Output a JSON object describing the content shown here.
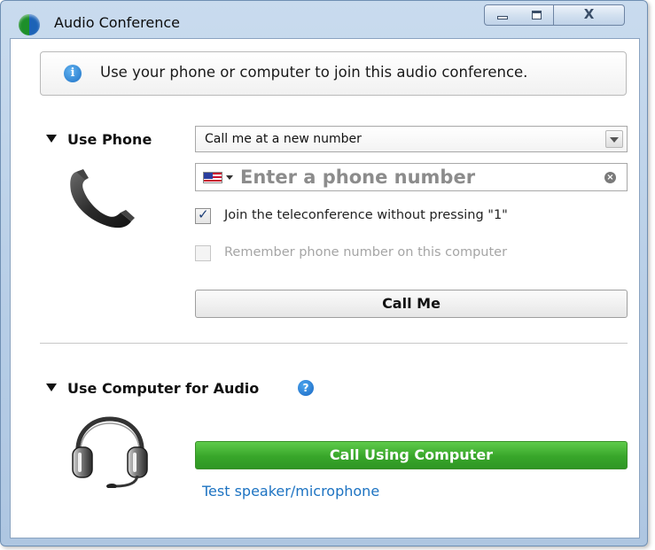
{
  "window": {
    "title": "Audio Conference",
    "controls": {
      "minimize": "minimize",
      "maximize": "maximize",
      "close": "X"
    }
  },
  "info": {
    "icon": "info-icon",
    "text": "Use your phone or computer to join this audio conference."
  },
  "phone_section": {
    "label": "Use Phone",
    "select_value": "Call me at a new number",
    "input_placeholder": "Enter a phone number",
    "checkbox_join": {
      "label": "Join the teleconference without pressing \"1\"",
      "checked": true
    },
    "checkbox_remember": {
      "label": "Remember phone number on this computer",
      "checked": false,
      "disabled": true
    },
    "call_button": "Call Me"
  },
  "computer_section": {
    "label": "Use Computer for Audio",
    "help_icon": "?",
    "call_button": "Call Using Computer",
    "test_link": "Test speaker/microphone"
  },
  "colors": {
    "accent_blue": "#1d73c2",
    "green_button": "#38a62a",
    "title_bar": "#b6cde6"
  }
}
